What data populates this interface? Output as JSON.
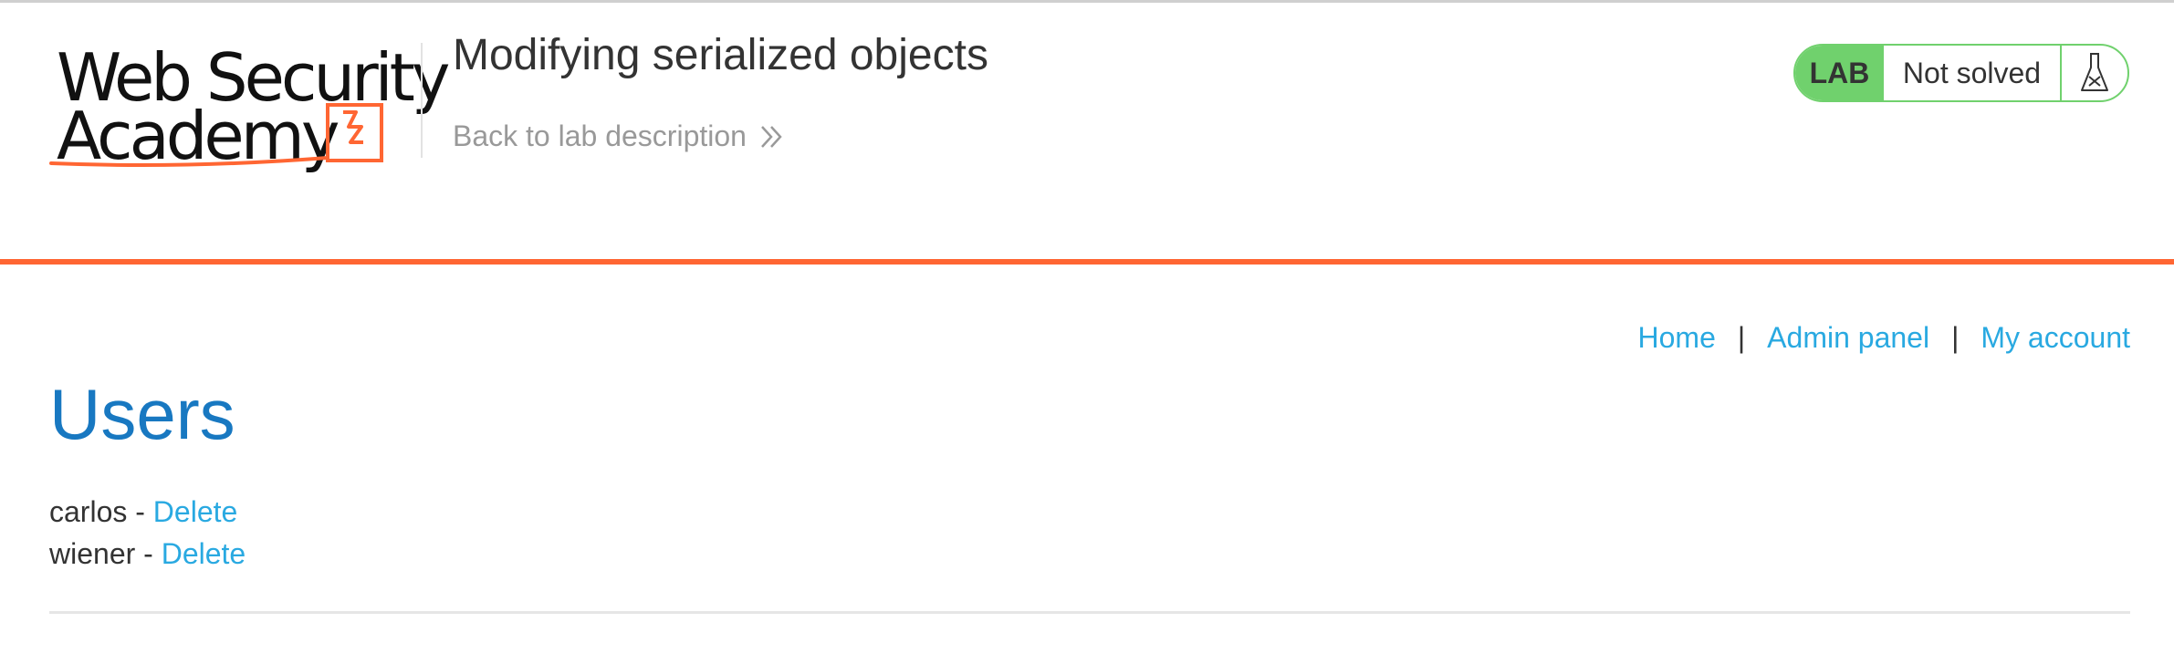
{
  "header": {
    "logo_line1": "Web Security",
    "logo_line2": "Academy",
    "lab_title": "Modifying serialized objects",
    "back_link": "Back to lab description",
    "lab_badge": "LAB",
    "lab_status": "Not solved"
  },
  "nav": {
    "home": "Home",
    "separator": "|",
    "admin_panel": "Admin panel",
    "my_account": "My account"
  },
  "main": {
    "heading": "Users",
    "users": [
      {
        "name": "carlos",
        "dash": "-",
        "action": "Delete"
      },
      {
        "name": "wiener",
        "dash": "-",
        "action": "Delete"
      }
    ]
  },
  "colors": {
    "accent_orange": "#ff6633",
    "link_blue": "#29a9e1",
    "heading_blue": "#1878c1",
    "lab_green": "#70d16d"
  },
  "icons": {
    "logo_bolt": "lightning-bolt-icon",
    "back_chevrons": "double-chevron-right-icon",
    "lab_flask": "flask-icon"
  }
}
